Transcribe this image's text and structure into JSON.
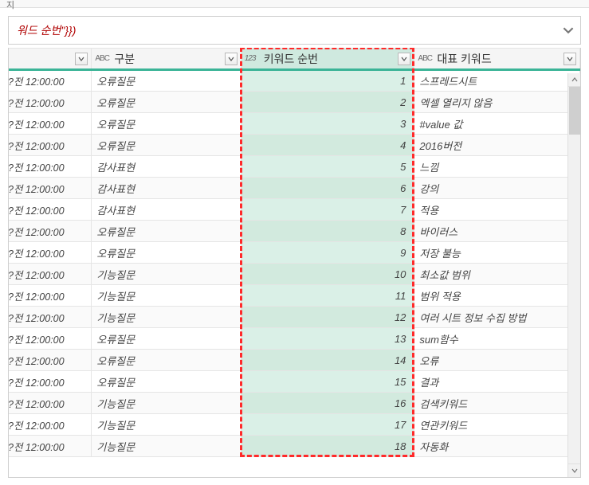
{
  "formula_fragment": "워드 순번\"}})",
  "columns": {
    "time": {
      "label": "",
      "type_icon": ""
    },
    "class": {
      "label": "구분",
      "type_icon": "ABC"
    },
    "seq": {
      "label": "키워드 순번",
      "type_icon": "123"
    },
    "keyword": {
      "label": "대표 키워드",
      "type_icon": "ABC"
    }
  },
  "time_label_fragment": "전 12:00:00",
  "rows": [
    {
      "class": "오류질문",
      "seq": 1,
      "keyword": "스프레드시트"
    },
    {
      "class": "오류질문",
      "seq": 2,
      "keyword": "엑셀 열리지 않음"
    },
    {
      "class": "오류질문",
      "seq": 3,
      "keyword": "#value 값"
    },
    {
      "class": "오류질문",
      "seq": 4,
      "keyword": "2016버전"
    },
    {
      "class": "감사표현",
      "seq": 5,
      "keyword": "느낌"
    },
    {
      "class": "감사표현",
      "seq": 6,
      "keyword": "강의"
    },
    {
      "class": "감사표현",
      "seq": 7,
      "keyword": "적용"
    },
    {
      "class": "오류질문",
      "seq": 8,
      "keyword": "바이러스"
    },
    {
      "class": "오류질문",
      "seq": 9,
      "keyword": "저장 불능"
    },
    {
      "class": "기능질문",
      "seq": 10,
      "keyword": "최소값 범위"
    },
    {
      "class": "기능질문",
      "seq": 11,
      "keyword": "범위 적용"
    },
    {
      "class": "기능질문",
      "seq": 12,
      "keyword": "여러 시트 정보 수집 방법"
    },
    {
      "class": "오류질문",
      "seq": 13,
      "keyword": "sum함수"
    },
    {
      "class": "오류질문",
      "seq": 14,
      "keyword": "오류"
    },
    {
      "class": "오류질문",
      "seq": 15,
      "keyword": "결과"
    },
    {
      "class": "기능질문",
      "seq": 16,
      "keyword": "검색키워드"
    },
    {
      "class": "기능질문",
      "seq": 17,
      "keyword": "연관키워드"
    },
    {
      "class": "기능질문",
      "seq": 18,
      "keyword": "자동화"
    }
  ],
  "chart_data": {
    "type": "table",
    "columns": [
      "구분",
      "키워드 순번",
      "대표 키워드"
    ],
    "rows": [
      [
        "오류질문",
        1,
        "스프레드시트"
      ],
      [
        "오류질문",
        2,
        "엑셀 열리지 않음"
      ],
      [
        "오류질문",
        3,
        "#value 값"
      ],
      [
        "오류질문",
        4,
        "2016버전"
      ],
      [
        "감사표현",
        5,
        "느낌"
      ],
      [
        "감사표현",
        6,
        "강의"
      ],
      [
        "감사표현",
        7,
        "적용"
      ],
      [
        "오류질문",
        8,
        "바이러스"
      ],
      [
        "오류질문",
        9,
        "저장 불능"
      ],
      [
        "기능질문",
        10,
        "최소값 범위"
      ],
      [
        "기능질문",
        11,
        "범위 적용"
      ],
      [
        "기능질문",
        12,
        "여러 시트 정보 수집 방법"
      ],
      [
        "오류질문",
        13,
        "sum함수"
      ],
      [
        "오류질문",
        14,
        "오류"
      ],
      [
        "오류질문",
        15,
        "결과"
      ],
      [
        "기능질문",
        16,
        "검색키워드"
      ],
      [
        "기능질문",
        17,
        "연관키워드"
      ],
      [
        "기능질문",
        18,
        "자동화"
      ]
    ]
  }
}
